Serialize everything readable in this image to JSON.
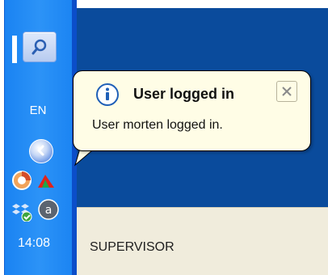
{
  "taskbar": {
    "language_indicator": "EN",
    "clock_time": "14:08",
    "icons": {
      "search": "search-icon",
      "collapse": "chevron-left-icon",
      "tray_1": "chrome-like-icon",
      "tray_2": "acrobat-like-icon",
      "tray_3": "dropbox-like-icon",
      "tray_4": "a-circle-icon"
    }
  },
  "notification": {
    "title": "User logged in",
    "message": "User morten logged in.",
    "icons": {
      "info": "info-icon",
      "close": "close-icon"
    }
  },
  "desktop": {
    "label": "SUPERVISOR"
  }
}
